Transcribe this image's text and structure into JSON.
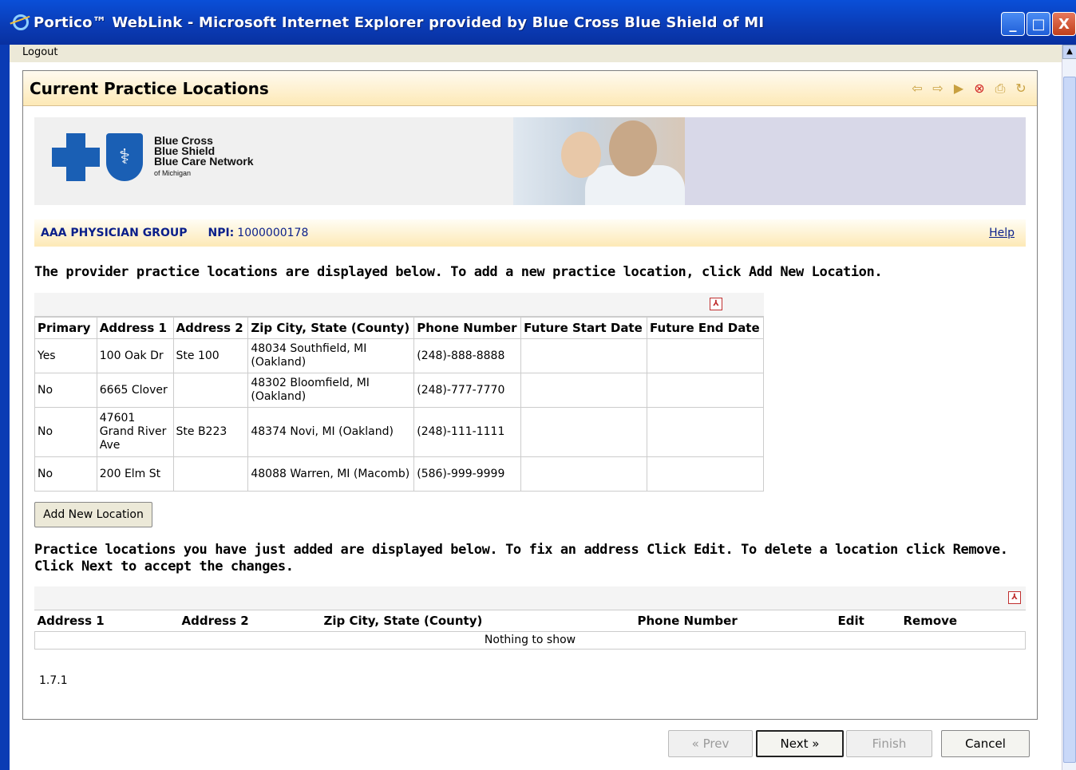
{
  "window": {
    "title": "Portico™ WebLink - Microsoft Internet Explorer provided by Blue Cross Blue Shield of MI",
    "controls": {
      "minimize": "_",
      "maximize": "□",
      "close": "X"
    }
  },
  "menubar": {
    "logout_label": "Logout"
  },
  "panel": {
    "title": "Current Practice Locations"
  },
  "toolbar_icons": [
    "back-icon",
    "forward-icon",
    "play-icon",
    "stop-icon",
    "print-icon",
    "refresh-icon"
  ],
  "brand": {
    "line1": "Blue Cross",
    "line2": "Blue Shield",
    "line3": "Blue Care Network",
    "line4": "of Michigan"
  },
  "provider": {
    "group_name": "AAA PHYSICIAN GROUP",
    "npi_label": "NPI:",
    "npi_value": "1000000178",
    "help_label": "Help"
  },
  "intro_text": "The provider practice locations are displayed below. To add a new practice location, click Add New Location.",
  "locations_table": {
    "columns": [
      "Primary",
      "Address 1",
      "Address 2",
      "Zip City, State (County)",
      "Phone Number",
      "Future Start Date",
      "Future End Date"
    ],
    "rows": [
      [
        "Yes",
        "100 Oak Dr",
        "Ste 100",
        "48034 Southfield, MI (Oakland)",
        "(248)-888-8888",
        "",
        ""
      ],
      [
        "No",
        "6665 Clover",
        "",
        "48302 Bloomfield, MI (Oakland)",
        "(248)-777-7770",
        "",
        ""
      ],
      [
        "No",
        "47601 Grand River Ave",
        "Ste B223",
        "48374 Novi, MI (Oakland)",
        "(248)-111-1111",
        "",
        ""
      ],
      [
        "No",
        "200 Elm St",
        "",
        "48088 Warren, MI (Macomb)",
        "(586)-999-9999",
        "",
        ""
      ]
    ]
  },
  "add_button_label": "Add New Location",
  "intro2_text": "Practice locations you have just added are displayed below. To fix an address Click Edit. To delete a location click Remove. Click Next to accept the changes.",
  "new_locations_table": {
    "columns": [
      "Address 1",
      "Address 2",
      "Zip City, State (County)",
      "Phone Number",
      "Edit",
      "Remove"
    ],
    "empty_text": "Nothing to show"
  },
  "version": "1.7.1",
  "wizard_buttons": {
    "prev": "« Prev",
    "next": "Next »",
    "finish": "Finish",
    "cancel": "Cancel"
  },
  "colors": {
    "titlebar": "#0a3bb4",
    "accent_bar": "#fde9b6",
    "link": "#0a1f8a"
  }
}
